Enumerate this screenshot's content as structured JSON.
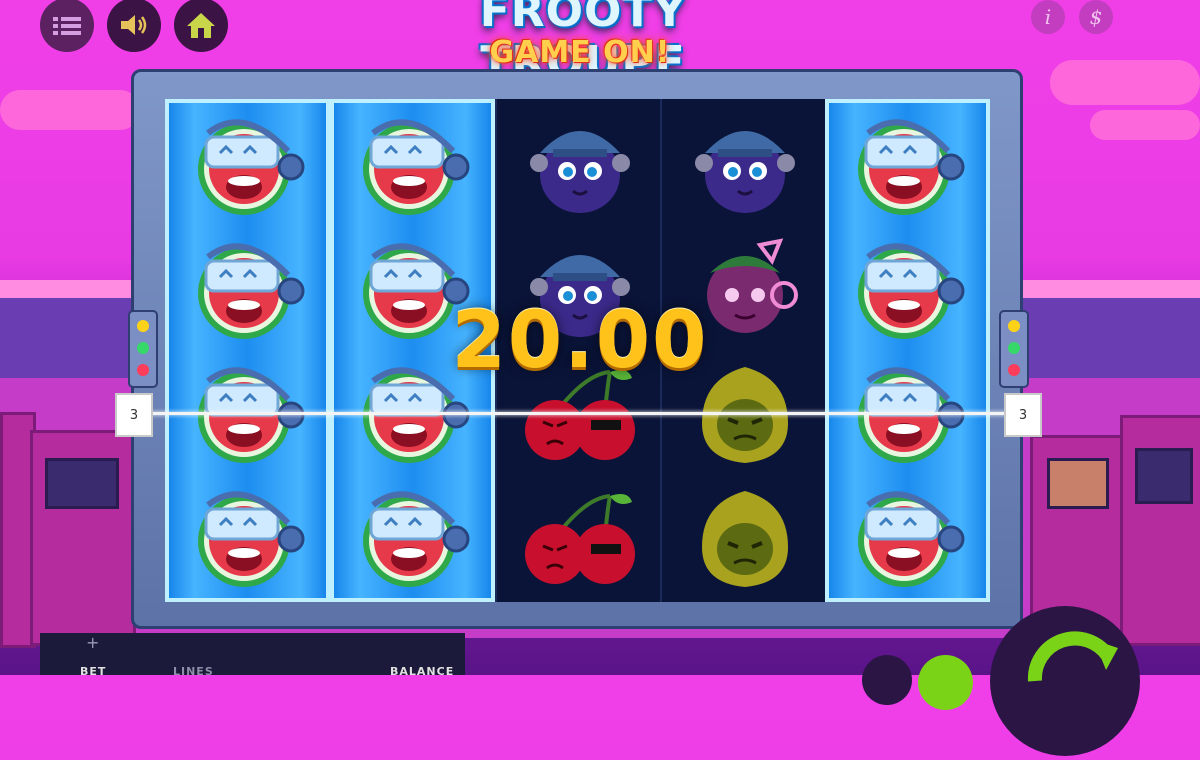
{
  "title": {
    "main": "FROOTY TROUPE",
    "sub": "GAME ON!"
  },
  "controls": {
    "menu_icon": "hamburger-icon",
    "sound_icon": "speaker-icon",
    "home_icon": "home-icon",
    "info_label": "i",
    "paytable_label": "$"
  },
  "reels": [
    [
      "watermelon",
      "watermelon",
      "watermelon",
      "watermelon"
    ],
    [
      "watermelon",
      "watermelon",
      "watermelon",
      "watermelon"
    ],
    [
      "plum",
      "plum",
      "cherry",
      "cherry"
    ],
    [
      "plum",
      "grape",
      "lemon",
      "lemon"
    ],
    [
      "watermelon",
      "watermelon",
      "watermelon",
      "watermelon"
    ]
  ],
  "win": {
    "amount": "20.00",
    "line_number_left": "3",
    "line_number_right": "3"
  },
  "bottom": {
    "bet_label": "BET",
    "lines_label": "LINES",
    "balance_label": "BALANCE",
    "plus_label": "+"
  },
  "colors": {
    "wild_reel": "#1d8df0",
    "win_amount": "#ffc21a",
    "background": "#e83be4",
    "spin_button": "#7bd318"
  }
}
